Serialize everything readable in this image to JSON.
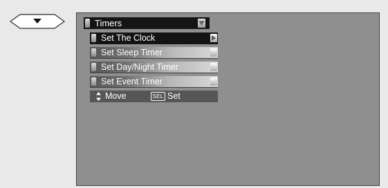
{
  "nav": {
    "icon": "chevron-down-icon"
  },
  "menu": {
    "title": "Timers",
    "items": [
      {
        "label": "Set The Clock",
        "selected": true
      },
      {
        "label": "Set Sleep Timer",
        "selected": false
      },
      {
        "label": "Set Day/Night Timer",
        "selected": false
      },
      {
        "label": "Set Event Timer",
        "selected": false
      }
    ]
  },
  "help": {
    "move_icon": "updown-arrows-icon",
    "move_label": "Move",
    "sel_key": "SEL",
    "set_label": "Set"
  },
  "colors": {
    "screen_bg": "#8f8f8f",
    "title_bg": "#141414",
    "selected_bg": "#141414",
    "help_bg": "#565656",
    "text": "#ffffff"
  }
}
